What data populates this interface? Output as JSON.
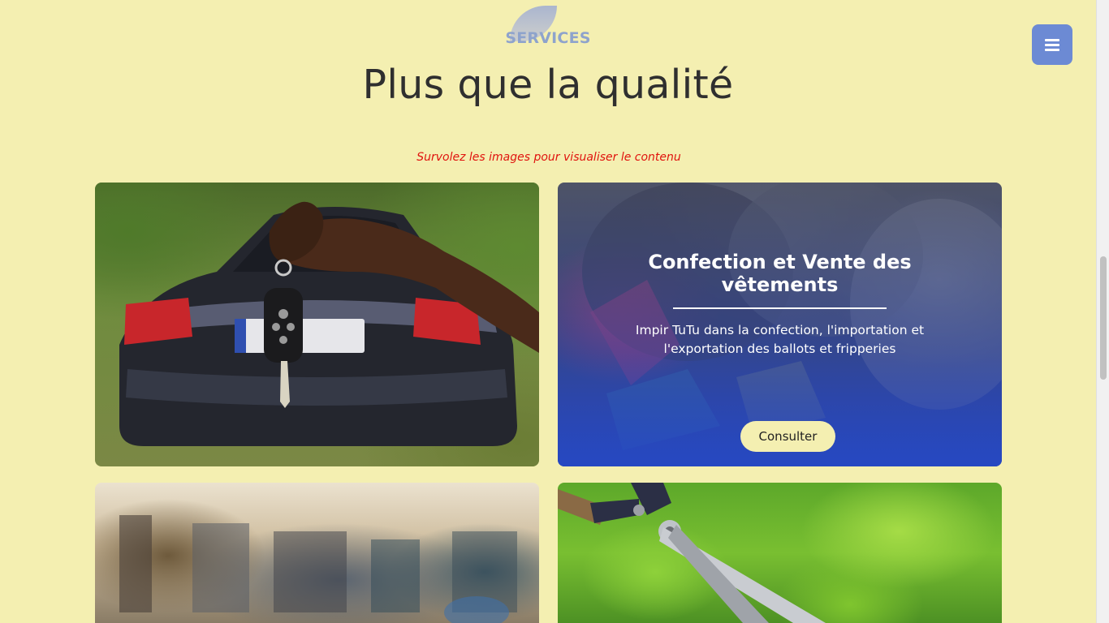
{
  "header": {
    "badge": "SERVICES",
    "title": "Plus que la qualité",
    "hint": "Survolez les images pour visualiser le contenu"
  },
  "menu": {
    "icon": "hamburger-menu-icon"
  },
  "cards": [
    {
      "image": "car-key-photo"
    },
    {
      "image": "clothing-bales-photo",
      "title": "Confection et Vente des vêtements",
      "description": "Impir TuTu dans la confection, l'importation et l'exportation des ballots et fripperies",
      "button_label": "Consulter"
    },
    {
      "image": "gym-photo"
    },
    {
      "image": "hedge-shears-photo"
    }
  ],
  "colors": {
    "page_background": "#f4efb1",
    "menu_button": "#6c8ad4",
    "hint_text": "#e0130e",
    "overlay_blue": "#2648c4"
  }
}
